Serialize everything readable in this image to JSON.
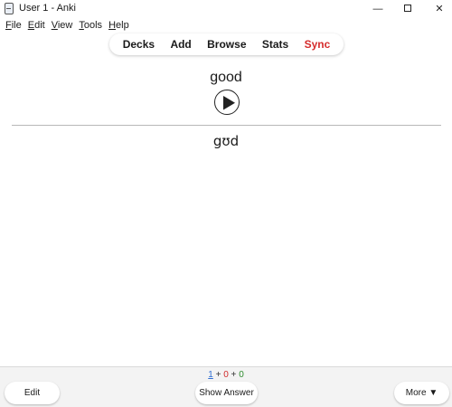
{
  "window": {
    "title": "User 1 - Anki",
    "minimize": "—",
    "close": "✕"
  },
  "menu": {
    "items": [
      {
        "mnemonic": "F",
        "rest": "ile"
      },
      {
        "mnemonic": "E",
        "rest": "dit"
      },
      {
        "mnemonic": "V",
        "rest": "iew"
      },
      {
        "mnemonic": "T",
        "rest": "ools"
      },
      {
        "mnemonic": "H",
        "rest": "elp"
      }
    ]
  },
  "toolbar": {
    "decks": "Decks",
    "add": "Add",
    "browse": "Browse",
    "stats": "Stats",
    "sync": "Sync",
    "sync_color": "#d52c2c"
  },
  "card": {
    "front": "good",
    "audio_icon": "play-icon",
    "back": "gʊd"
  },
  "counts": {
    "new": "1",
    "learning": "0",
    "review": "0",
    "sep": " + ",
    "new_color": "#2f6ed3",
    "learning_color": "#d02929",
    "review_color": "#2e8b2e"
  },
  "bottom": {
    "edit": "Edit",
    "show_answer": "Show Answer",
    "more": "More ▼"
  }
}
